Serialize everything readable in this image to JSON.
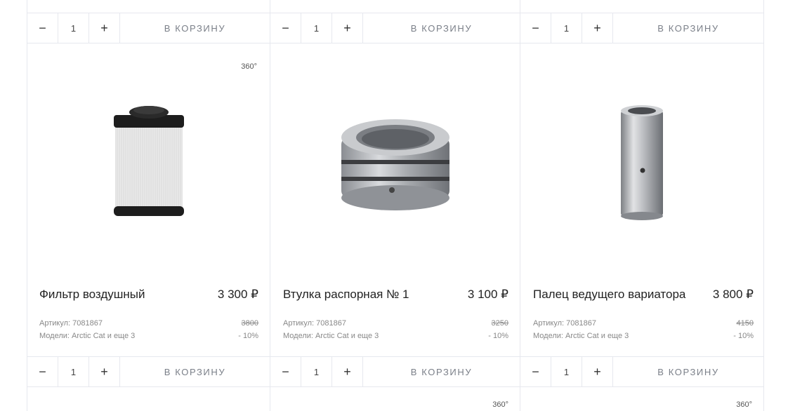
{
  "cart": {
    "minus": "−",
    "plus": "+",
    "qty": "1",
    "add_label": "В КОРЗИНУ"
  },
  "badge_360": "360°",
  "labels": {
    "article_prefix": "Артикул:",
    "models_prefix": "Модели:"
  },
  "products": [
    {
      "name": "Фильтр воздушный",
      "price": "3 300 ₽",
      "article": "Артикул: 7081867",
      "old_price": "3800",
      "models": "Модели: Arctic Cat и еще 3",
      "discount": "- 10%",
      "icon": "air-filter-image"
    },
    {
      "name": "Втулка распорная № 1",
      "price": "3 100 ₽",
      "article": "Артикул: 7081867",
      "old_price": "3250",
      "models": "Модели: Arctic Cat и еще 3",
      "discount": "- 10%",
      "icon": "spacer-bushing-image"
    },
    {
      "name": "Палец ведущего вариатора",
      "price": "3 800 ₽",
      "article": "Артикул: 7081867",
      "old_price": "4150",
      "models": "Модели: Arctic Cat и еще 3",
      "discount": "- 10%",
      "icon": "variator-pin-image"
    }
  ]
}
